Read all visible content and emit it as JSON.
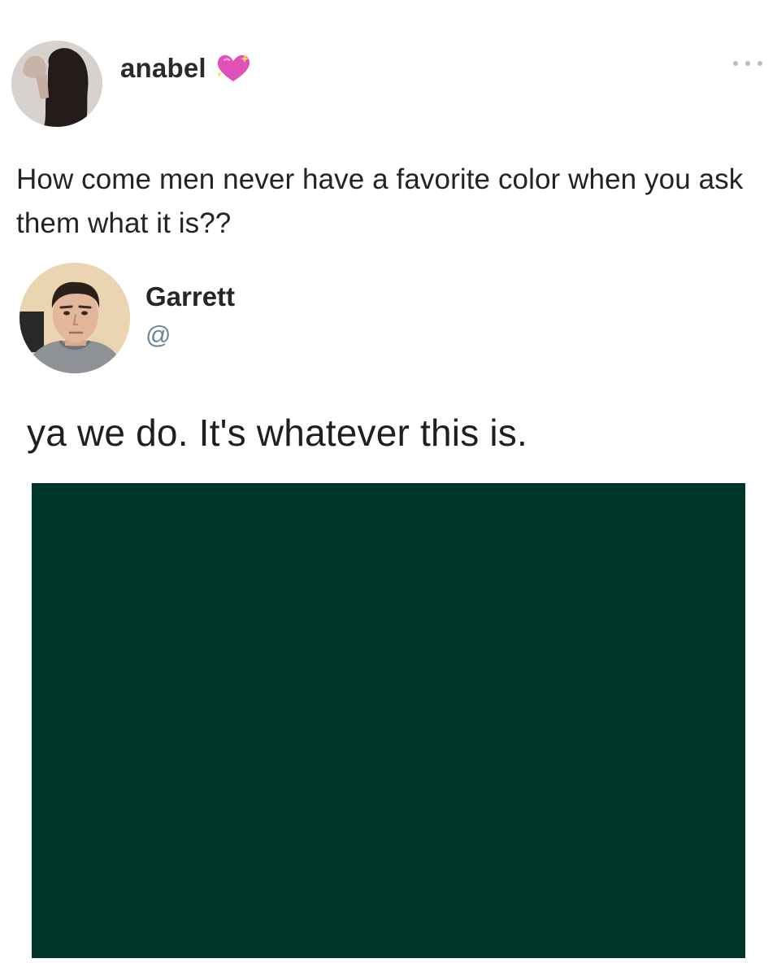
{
  "original_post": {
    "author_name": "anabel",
    "name_icon": "sparkling-heart-icon",
    "menu_icon": "more-options-icon",
    "text": "How come men never have a favorite color when you ask them what it is??"
  },
  "reply_post": {
    "author_name": "Garrett",
    "handle": "@",
    "text": "ya we do. It's whatever this is.",
    "image": {
      "type": "solid-color-swatch",
      "color": "#00352a"
    }
  },
  "colors": {
    "background": "#ffffff",
    "text": "#1f1f1f",
    "handle": "#6b8596",
    "heart": "#e14fb8",
    "swatch": "#00352a"
  }
}
